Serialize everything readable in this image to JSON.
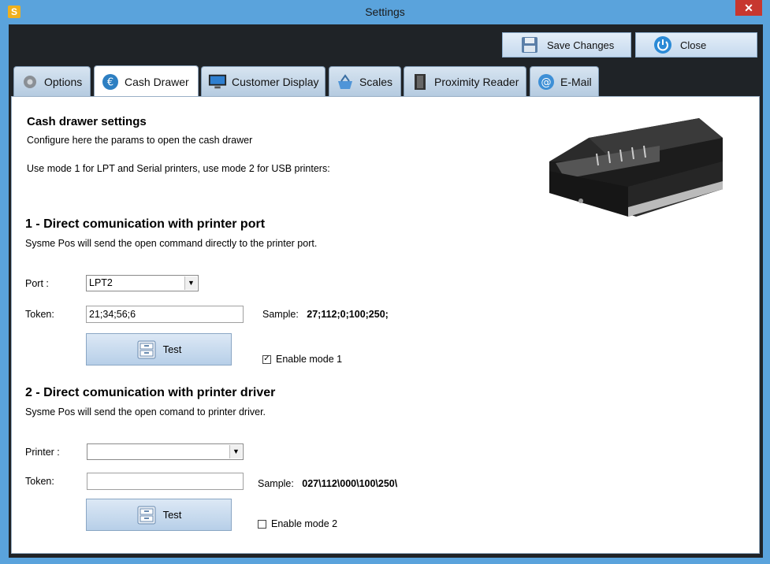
{
  "window": {
    "title": "Settings",
    "app_icon_letter": "S",
    "close_glyph": "✕"
  },
  "toolbar": {
    "save_label": "Save Changes",
    "close_label": "Close"
  },
  "tabs": [
    {
      "label": "Options",
      "icon": "gear-icon"
    },
    {
      "label": "Cash Drawer",
      "icon": "euro-icon",
      "active": true
    },
    {
      "label": "Customer Display",
      "icon": "monitor-icon"
    },
    {
      "label": "Scales",
      "icon": "basket-icon"
    },
    {
      "label": "Proximity Reader",
      "icon": "film-icon"
    },
    {
      "label": "E-Mail",
      "icon": "at-icon"
    }
  ],
  "header": {
    "title": "Cash drawer settings",
    "subtitle": "Configure here the params to open the cash drawer",
    "note": "Use mode 1 for LPT and Serial printers, use mode 2 for USB printers:"
  },
  "mode1": {
    "title": "1 - Direct comunication with printer port",
    "description": "Sysme Pos will send the open command directly to the printer port.",
    "port_label": "Port :",
    "port_value": "LPT2",
    "token_label": "Token:",
    "token_value": "21;34;56;6",
    "sample_label": "Sample:",
    "sample_value": "27;112;0;100;250;",
    "test_label": "Test",
    "enable_label": "Enable mode 1",
    "enabled": true
  },
  "mode2": {
    "title": "2 - Direct comunication with printer driver",
    "description": "Sysme Pos will send the open comand to printer driver.",
    "printer_label": "Printer :",
    "printer_value": "",
    "token_label": "Token:",
    "token_value": "",
    "sample_label": "Sample:",
    "sample_value": "027\\112\\000\\100\\250\\",
    "test_label": "Test",
    "enable_label": "Enable mode 2",
    "enabled": false
  },
  "colors": {
    "titlebar": "#5aa3dc",
    "client_bg": "#1f2327",
    "button_gradient_top": "#e4eef8",
    "button_gradient_bottom": "#c5d9ee"
  }
}
